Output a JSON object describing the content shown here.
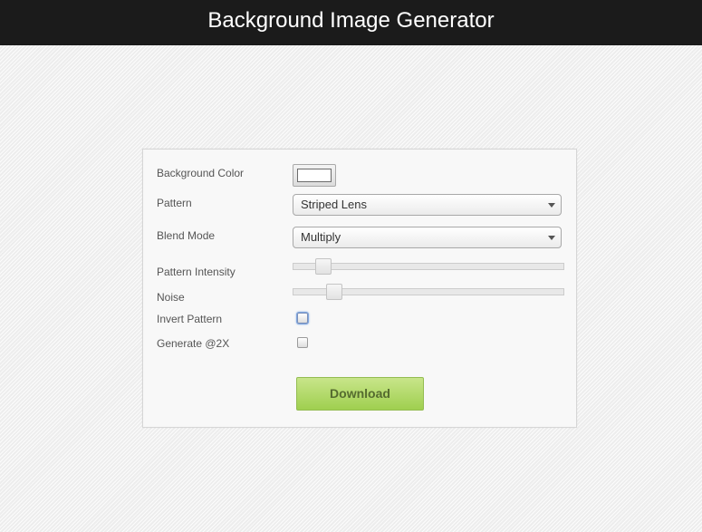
{
  "header": {
    "title": "Background Image Generator"
  },
  "form": {
    "background_color": {
      "label": "Background Color",
      "value": "#ffffff"
    },
    "pattern": {
      "label": "Pattern",
      "selected": "Striped Lens"
    },
    "blend_mode": {
      "label": "Blend Mode",
      "selected": "Multiply"
    },
    "pattern_intensity": {
      "label": "Pattern Intensity",
      "level": 0.11
    },
    "noise": {
      "label": "Noise",
      "level": 0.15
    },
    "invert_pattern": {
      "label": "Invert Pattern",
      "checked": false,
      "focused": true
    },
    "generate_2x": {
      "label": "Generate @2X",
      "checked": false
    },
    "download": {
      "label": "Download"
    }
  },
  "icons": {
    "pattern_dropdown": "chevron-down-icon",
    "blend_dropdown": "chevron-down-icon"
  },
  "colors": {
    "header_bg": "#1b1b1b",
    "download_button": "#b4dc6c"
  }
}
